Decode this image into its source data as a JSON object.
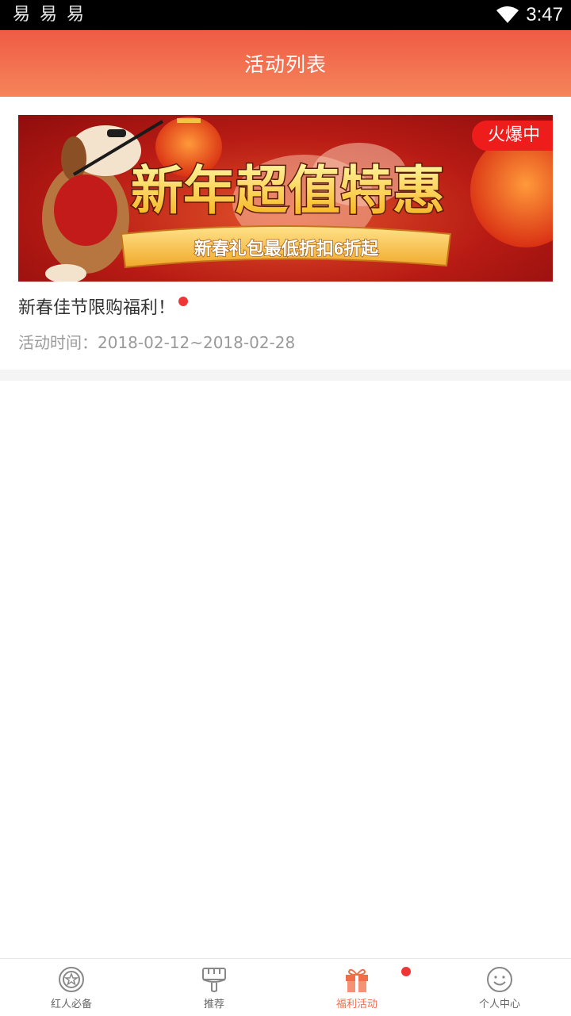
{
  "status_bar": {
    "left_glyphs": [
      "易",
      "易",
      "易"
    ],
    "time": "3:47",
    "wifi_icon": "wifi-icon"
  },
  "app_bar": {
    "title": "活动列表"
  },
  "activities": [
    {
      "badge": "火爆中",
      "banner": {
        "headline": "新年超值特惠",
        "subline": "新春礼包最低折扣6折起"
      },
      "title": "新春佳节限购福利！",
      "time_text": "活动时间：2018-02-12~2018-02-28",
      "unread": true
    }
  ],
  "tab_bar": {
    "items": [
      {
        "label": "红人必备",
        "icon": "badge-star-icon",
        "active": false,
        "dot": false
      },
      {
        "label": "推荐",
        "icon": "brush-icon",
        "active": false,
        "dot": false
      },
      {
        "label": "福利活动",
        "icon": "gift-icon",
        "active": true,
        "dot": true
      },
      {
        "label": "个人中心",
        "icon": "smiley-icon",
        "active": false,
        "dot": false
      }
    ]
  },
  "colors": {
    "accent": "#f06e4a",
    "appbar_top": "#ef5b45",
    "appbar_bottom": "#f5855a",
    "badge_red": "#ef1c1c",
    "dot_red": "#ef3535"
  }
}
